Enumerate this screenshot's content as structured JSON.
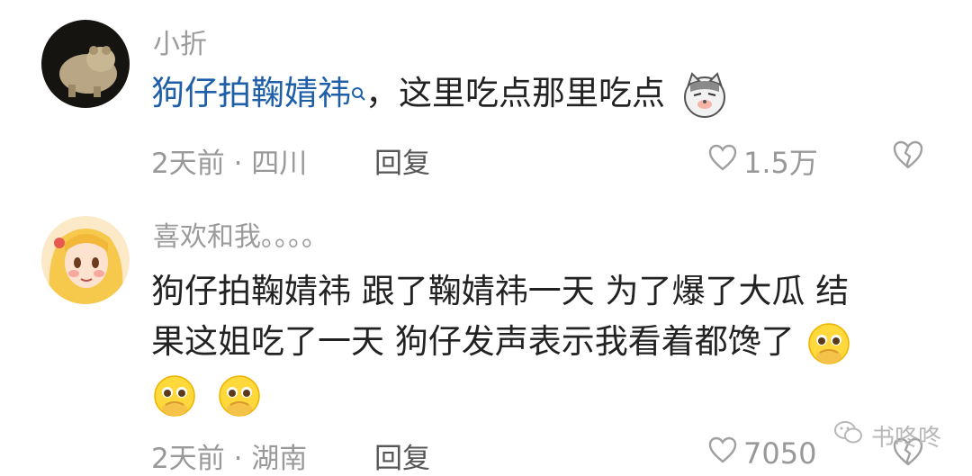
{
  "comments": [
    {
      "username": "小折",
      "link_text": "狗仔拍鞠婧祎",
      "text": "，这里吃点那里吃点",
      "time": "2天前",
      "location": "四川",
      "reply_label": "回复",
      "likes": "1.5万"
    },
    {
      "username": "喜欢和我。。。。",
      "lines": [
        "狗仔拍鞠婧祎 跟了鞠婧祎一天 为了爆了大瓜 结",
        "果这姐吃了一天 狗仔发声表示我看着都馋了"
      ],
      "time": "2天前",
      "location": "湖南",
      "reply_label": "回复",
      "likes": "7050"
    }
  ],
  "watermark": "书咚咚",
  "colors": {
    "link": "#1f5fa8",
    "meta": "#999999",
    "text": "#222222"
  }
}
